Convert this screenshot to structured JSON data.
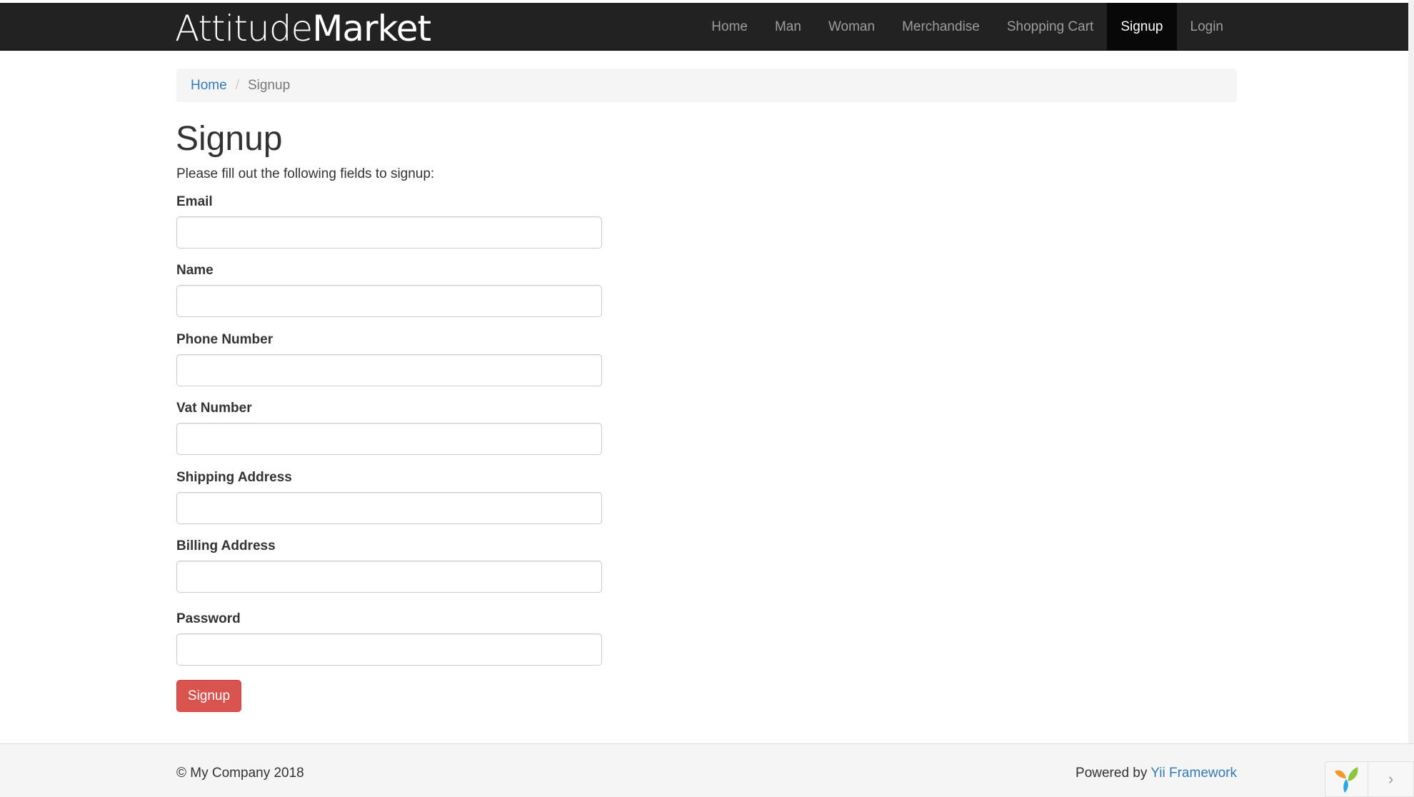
{
  "brand": {
    "part1": "Attitude",
    "part2": "Market"
  },
  "nav": {
    "items": [
      {
        "label": "Home"
      },
      {
        "label": "Man"
      },
      {
        "label": "Woman"
      },
      {
        "label": "Merchandise"
      },
      {
        "label": "Shopping Cart"
      },
      {
        "label": "Signup",
        "active": true
      },
      {
        "label": "Login"
      }
    ]
  },
  "breadcrumb": {
    "home": "Home",
    "separator": "/",
    "current": "Signup"
  },
  "page": {
    "title": "Signup",
    "intro": "Please fill out the following fields to signup:"
  },
  "form": {
    "fields": [
      {
        "label": "Email",
        "value": "",
        "placeholder": ""
      },
      {
        "label": "Name",
        "value": "",
        "placeholder": ""
      },
      {
        "label": "Phone Number",
        "value": "",
        "placeholder": ""
      },
      {
        "label": "Vat Number",
        "value": "",
        "placeholder": ""
      },
      {
        "label": "Shipping Address",
        "value": "",
        "placeholder": ""
      },
      {
        "label": "Billing Address",
        "value": "",
        "placeholder": ""
      },
      {
        "label": "Password",
        "value": "",
        "placeholder": ""
      }
    ],
    "submit_label": "Signup"
  },
  "footer": {
    "copyright": "© My Company 2018",
    "powered_prefix": "Powered by",
    "powered_link": "Yii Framework"
  },
  "debug_toolbar": {
    "logo_icon": "yii-logo-icon",
    "toggle_icon": "chevron-right-icon"
  },
  "colors": {
    "navbar_bg": "#222222",
    "nav_active_bg": "#080808",
    "link": "#337ab7",
    "danger_button": "#d9534f"
  }
}
